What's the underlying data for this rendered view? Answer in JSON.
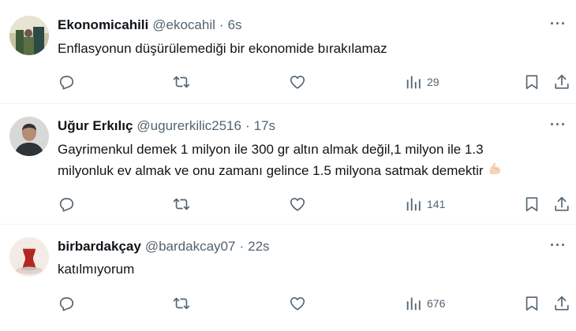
{
  "tweets": [
    {
      "name": "Ekonomicahili",
      "handle": "@ekocahil",
      "time": "6s",
      "text": "Enflasyonun düşürülemediği bir ekonomide bırakılamaz",
      "views": "29",
      "avatar_icon": "profile-photo"
    },
    {
      "name": "Uğur Erkılıç",
      "handle": "@ugurerkilic2516",
      "time": "17s",
      "text_line1": "Gayrimenkul demek 1 milyon ile 300 gr altın almak değil,1 milyon ile 1.3",
      "text_line2": "milyonluk ev almak ve onu zamanı gelince 1.5 milyona satmak demektir",
      "emoji_icon": "flexed-biceps-emoji",
      "views": "141",
      "avatar_icon": "profile-photo"
    },
    {
      "name": "birbardakçay",
      "handle": "@bardakcay07",
      "time": "22s",
      "text": "katılmıyorum",
      "views": "676",
      "avatar_icon": "tea-glass-photo"
    }
  ],
  "more_label": "···",
  "separator": "·",
  "colors": {
    "text": "#0f1419",
    "muted": "#536471",
    "divider": "#eff3f4"
  }
}
